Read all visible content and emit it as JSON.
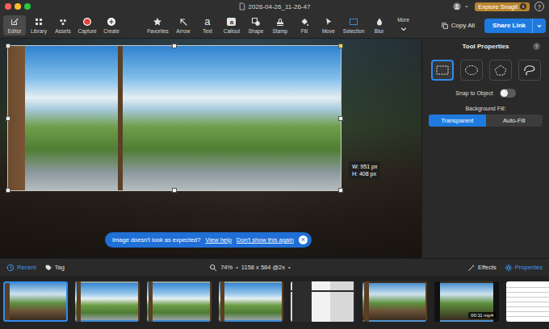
{
  "window": {
    "title": "2026-04-26_11-26-47",
    "explore": "Explore Snagit",
    "explore_info": "i",
    "help": "?"
  },
  "nav": [
    {
      "label": "Editor",
      "selected": true
    },
    {
      "label": "Library",
      "selected": false
    },
    {
      "label": "Assets",
      "selected": false
    },
    {
      "label": "Capture",
      "selected": false
    },
    {
      "label": "Create",
      "selected": false
    }
  ],
  "tools": [
    {
      "label": "Favorites",
      "selected": false
    },
    {
      "label": "Arrow",
      "selected": false
    },
    {
      "label": "Text",
      "selected": false,
      "glyph": "a"
    },
    {
      "label": "Callout",
      "selected": false,
      "glyph": "a"
    },
    {
      "label": "Shape",
      "selected": false
    },
    {
      "label": "Stamp",
      "selected": false
    },
    {
      "label": "Fill",
      "selected": false
    },
    {
      "label": "Move",
      "selected": false
    },
    {
      "label": "Selection",
      "selected": true
    },
    {
      "label": "Blur",
      "selected": false
    },
    {
      "label": "More",
      "selected": false
    }
  ],
  "actions": {
    "copy": "Copy All",
    "share": "Share Link"
  },
  "canvas": {
    "width_label": "W: 951 px",
    "height_label": "H: 408 px"
  },
  "banner": {
    "message": "Image doesn't look as expected?",
    "links": [
      "View help",
      "Don't show this again"
    ],
    "close": "×"
  },
  "properties": {
    "title": "Tool Properties",
    "help": "?",
    "shapes": [
      {
        "kind": "rectangle",
        "selected": true
      },
      {
        "kind": "ellipse",
        "selected": false
      },
      {
        "kind": "polygon",
        "selected": false
      },
      {
        "kind": "lasso",
        "selected": false
      }
    ],
    "snap": {
      "label": "Snap to Object",
      "on": false
    },
    "fill": {
      "label": "Background Fill:",
      "options": [
        {
          "label": "Transparent",
          "selected": true
        },
        {
          "label": "Auto-Fill",
          "selected": false
        }
      ]
    }
  },
  "bottom_bar": {
    "left": [
      {
        "label": "Recent",
        "selected": true
      },
      {
        "label": "Tag",
        "selected": false
      }
    ],
    "zoom": "74%",
    "dimensions": "1158 x 584 @2x",
    "separator": "•",
    "right": [
      {
        "label": "Effects",
        "selected": false
      },
      {
        "label": "Properties",
        "selected": true
      }
    ]
  },
  "tray": [
    {
      "kind": "photo",
      "selected": true
    },
    {
      "kind": "landscape",
      "selected": false
    },
    {
      "kind": "landscape",
      "selected": false
    },
    {
      "kind": "landscape",
      "selected": false
    },
    {
      "kind": "screen",
      "selected": false
    },
    {
      "kind": "photo",
      "selected": false
    },
    {
      "kind": "video",
      "selected": false,
      "badge": "00:11 mp4"
    },
    {
      "kind": "document",
      "selected": false
    }
  ]
}
